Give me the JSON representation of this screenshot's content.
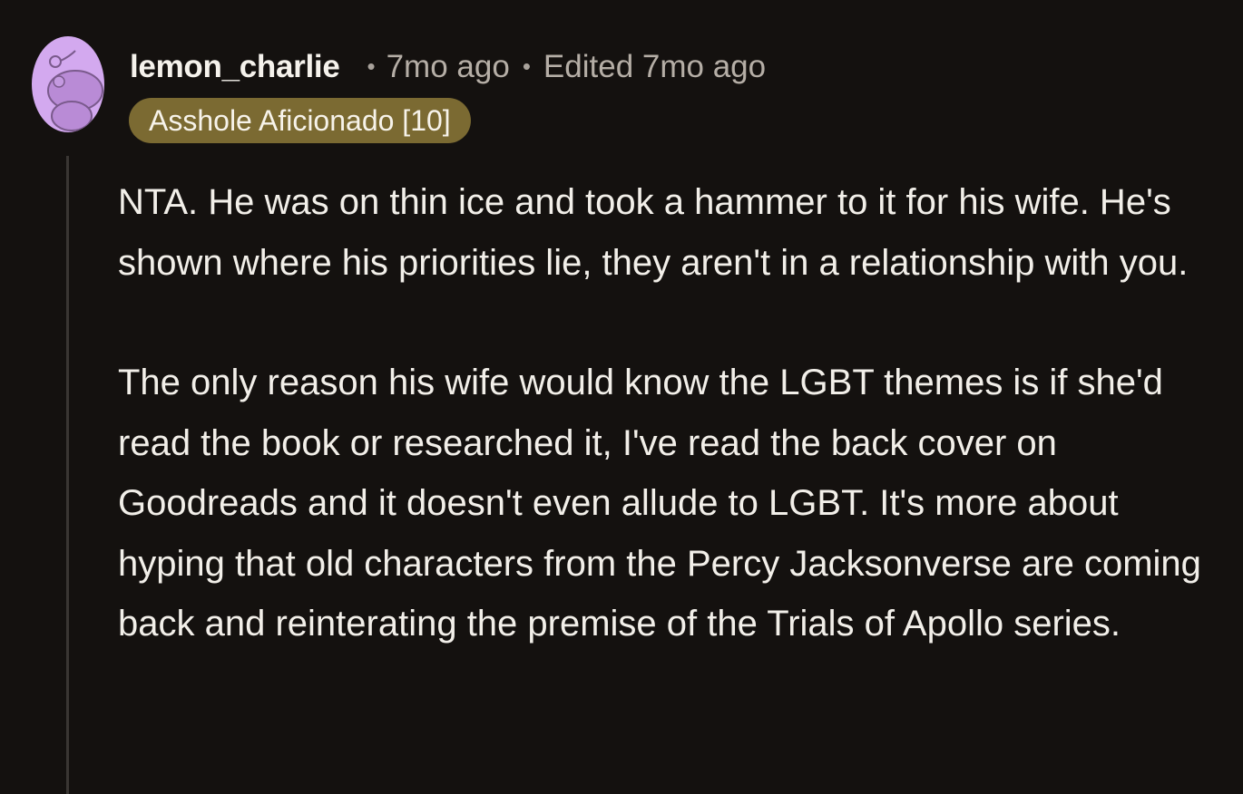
{
  "comment": {
    "username": "lemon_charlie",
    "separator": "•",
    "time": "7mo ago",
    "edited": "Edited 7mo ago",
    "flair": "Asshole Aficionado [10]",
    "avatar_icon": "snoo-avatar-icon",
    "paragraphs": [
      "NTA. He was on thin ice and took a hammer to it for his wife. He's shown where his priorities lie, they aren't in a relationship with you.",
      "The only reason his wife would know the LGBT themes is if she'd read the book or researched it, I've read the back cover on Goodreads and it doesn't even allude to LGBT. It's more about hyping that old characters from the Percy Jacksonverse are coming back and reinterating the premise of the Trials of Apollo series."
    ]
  },
  "colors": {
    "background": "#14110f",
    "avatar": "#d3a9ef",
    "flair": "#7b6a32",
    "thread_line": "#3a3633"
  }
}
